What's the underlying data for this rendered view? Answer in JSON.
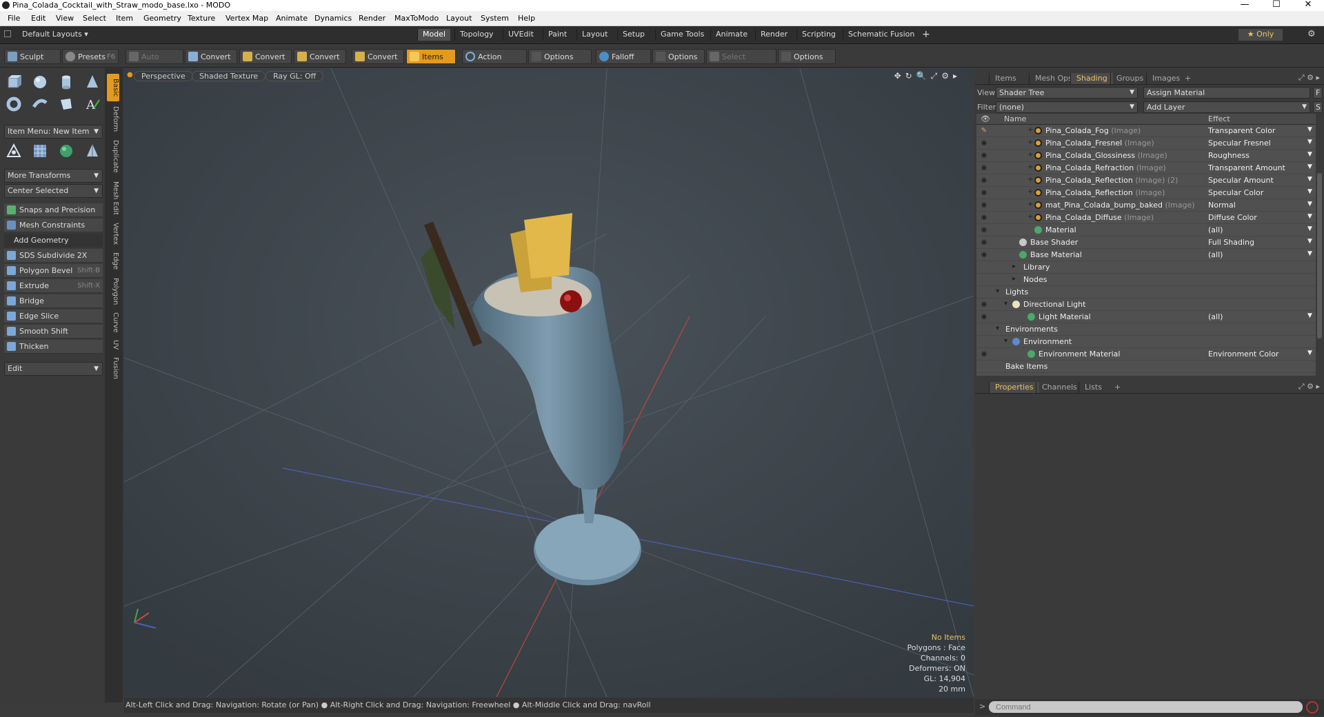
{
  "window": {
    "title": "Pina_Colada_Cocktail_with_Straw_modo_base.lxo - MODO",
    "min": "—",
    "max": "☐",
    "close": "✕"
  },
  "menu": [
    "File",
    "Edit",
    "View",
    "Select",
    "Item",
    "Geometry",
    "Texture",
    "Vertex Map",
    "Animate",
    "Dynamics",
    "Render",
    "MaxToModo",
    "Layout",
    "System",
    "Help"
  ],
  "layouts": {
    "label": "Default Layouts ▾"
  },
  "mode_tabs": [
    "Model",
    "Topology",
    "UVEdit",
    "Paint",
    "Layout",
    "Setup",
    "Game Tools",
    "Animate",
    "Render",
    "Scripting",
    "Schematic Fusion",
    "+"
  ],
  "only_btn": "★ Only",
  "toolbar": {
    "sculpt": "Sculpt",
    "presets": "Presets",
    "presets_key": "F6",
    "auto_select": "Auto Select",
    "convert1": "Convert",
    "convert2": "Convert",
    "convert3": "Convert",
    "convert4": "Convert",
    "items": "Items",
    "action_center": "Action Center",
    "options1": "Options",
    "falloff": "Falloff",
    "options2": "Options",
    "select_through": "Select Through",
    "options3": "Options"
  },
  "left": {
    "item_menu": "Item Menu: New Item",
    "more_transforms": "More Transforms",
    "center_selected": "Center Selected",
    "snaps": "Snaps and Precision",
    "mesh_constraints": "Mesh Constraints",
    "add_geometry": "Add Geometry",
    "tools": [
      {
        "label": "SDS Subdivide 2X",
        "shortcut": ""
      },
      {
        "label": "Polygon Bevel",
        "shortcut": "Shift-B"
      },
      {
        "label": "Extrude",
        "shortcut": "Shift-X"
      },
      {
        "label": "Bridge",
        "shortcut": ""
      },
      {
        "label": "Edge Slice",
        "shortcut": ""
      },
      {
        "label": "Smooth Shift",
        "shortcut": ""
      },
      {
        "label": "Thicken",
        "shortcut": ""
      }
    ],
    "edit": "Edit"
  },
  "vtabs": [
    "Basic",
    "Deform",
    "Duplicate",
    "Mesh Edit",
    "Vertex",
    "Edge",
    "Polygon",
    "Curve",
    "UV",
    "Fusion"
  ],
  "viewport": {
    "perspective": "Perspective",
    "shaded": "Shaded Texture",
    "raygl": "Ray GL: Off",
    "stats": {
      "items": "No Items",
      "polygons": "Polygons : Face",
      "channels": "Channels: 0",
      "deformers": "Deformers: ON",
      "gl": "GL: 14,904",
      "mm": "20 mm"
    }
  },
  "status": "Alt-Left Click and Drag: Navigation: Rotate (or Pan) ● Alt-Right Click and Drag: Navigation: Freewheel ● Alt-Middle Click and Drag: navRoll",
  "right": {
    "tabs": [
      "Items",
      "Mesh Ops",
      "Shading",
      "Groups",
      "Images",
      "+"
    ],
    "view_label": "View",
    "view_value": "Shader Tree",
    "assign": "Assign Material",
    "filter_label": "Filter",
    "filter_value": "(none)",
    "add_layer": "Add Layer",
    "col_name": "Name",
    "col_effect": "Effect",
    "rows": [
      {
        "name": "Pina_Colada_Fog",
        "tag": "(Image)",
        "effect": "Transparent Color"
      },
      {
        "name": "Pina_Colada_Fresnel",
        "tag": "(Image)",
        "effect": "Specular Fresnel"
      },
      {
        "name": "Pina_Colada_Glossiness",
        "tag": "(Image)",
        "effect": "Roughness"
      },
      {
        "name": "Pina_Colada_Refraction",
        "tag": "(Image)",
        "effect": "Transparent Amount"
      },
      {
        "name": "Pina_Colada_Reflection",
        "tag": "(Image) (2)",
        "effect": "Specular Amount"
      },
      {
        "name": "Pina_Colada_Reflection",
        "tag": "(Image)",
        "effect": "Specular Color"
      },
      {
        "name": "mat_Pina_Colada_bump_baked",
        "tag": "(Image)",
        "effect": "Normal"
      },
      {
        "name": "Pina_Colada_Diffuse",
        "tag": "(Image)",
        "effect": "Diffuse Color"
      },
      {
        "name": "Material",
        "tag": "",
        "effect": "(all)"
      },
      {
        "name": "Base Shader",
        "tag": "",
        "effect": "Full Shading"
      },
      {
        "name": "Base Material",
        "tag": "",
        "effect": "(all)"
      },
      {
        "name": "Library",
        "tag": "",
        "effect": ""
      },
      {
        "name": "Nodes",
        "tag": "",
        "effect": ""
      },
      {
        "name": "Lights",
        "tag": "",
        "effect": ""
      },
      {
        "name": "Directional Light",
        "tag": "",
        "effect": ""
      },
      {
        "name": "Light Material",
        "tag": "",
        "effect": "(all)"
      },
      {
        "name": "Environments",
        "tag": "",
        "effect": ""
      },
      {
        "name": "Environment",
        "tag": "",
        "effect": ""
      },
      {
        "name": "Environment Material",
        "tag": "",
        "effect": "Environment Color"
      },
      {
        "name": "Bake Items",
        "tag": "",
        "effect": ""
      }
    ],
    "prop_tabs": [
      "Properties",
      "Channels",
      "Lists",
      "+"
    ],
    "command_placeholder": "Command"
  }
}
